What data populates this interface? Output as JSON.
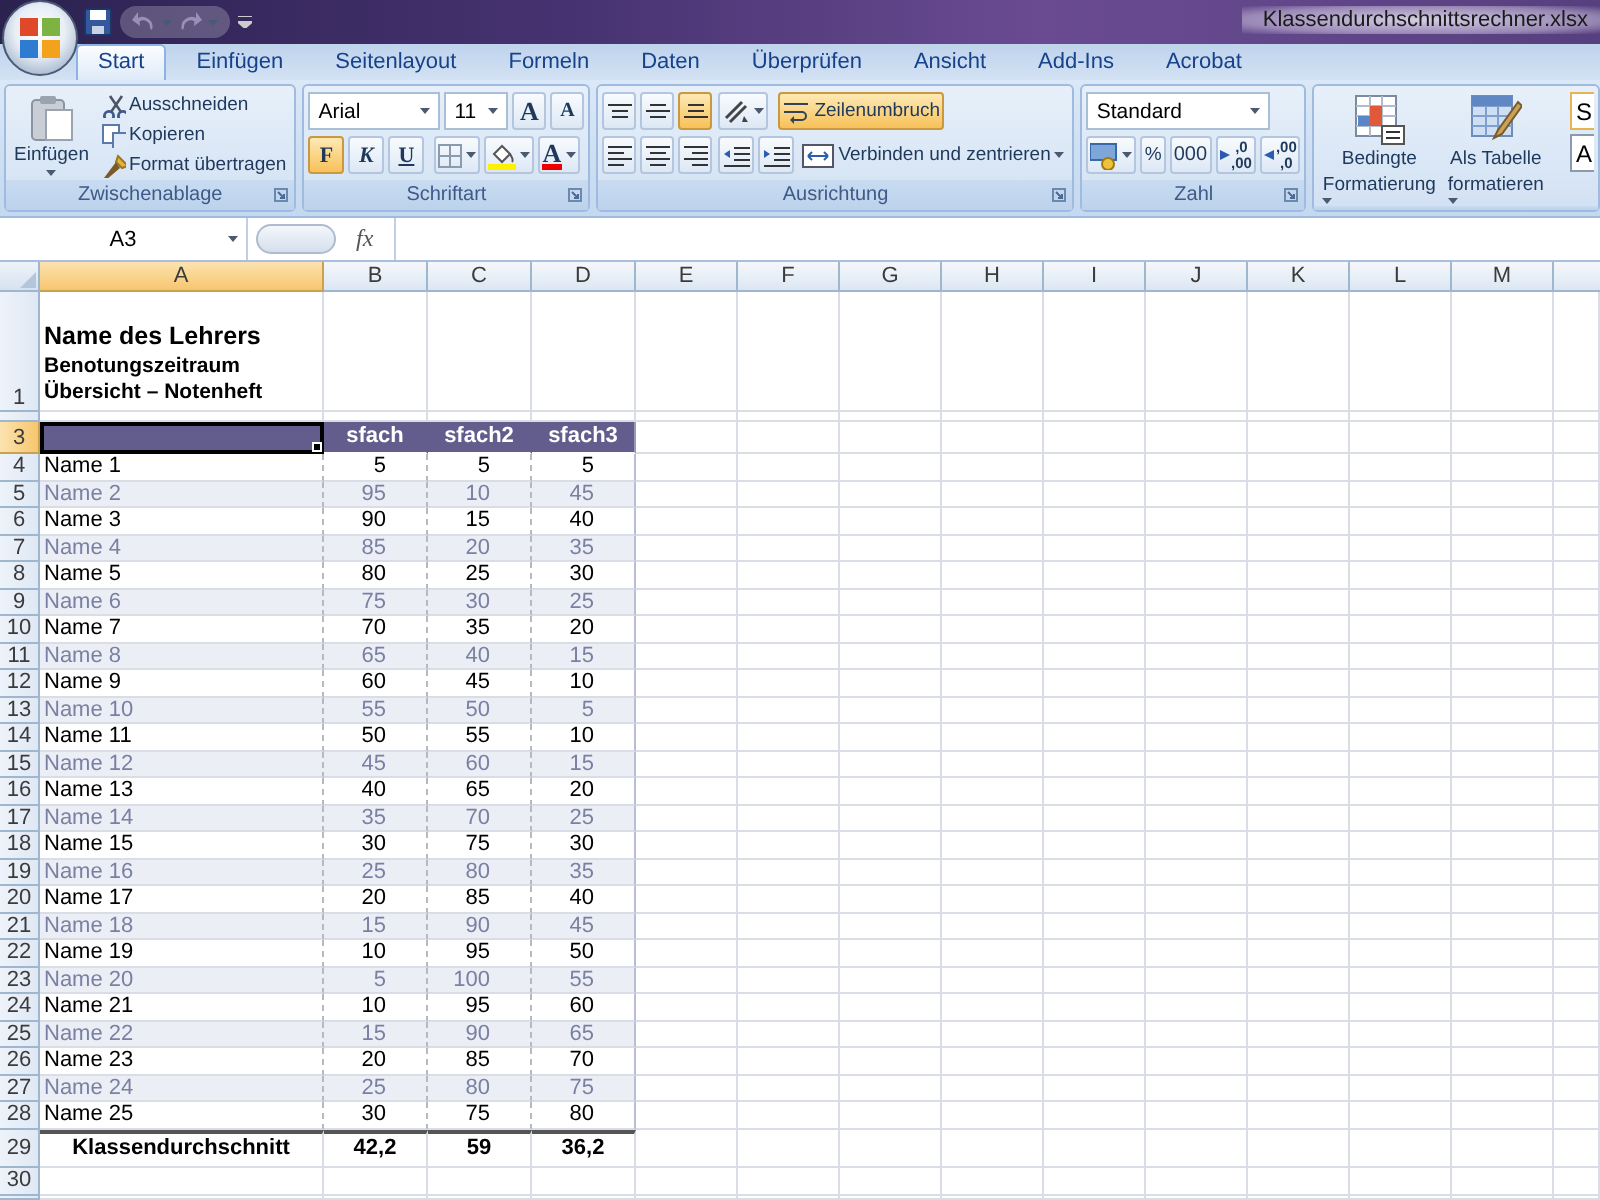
{
  "window": {
    "title": "Klassendurchschnittsrechner.xlsx"
  },
  "tabs": [
    {
      "label": "Start",
      "selected": true
    },
    {
      "label": "Einfügen",
      "selected": false
    },
    {
      "label": "Seitenlayout",
      "selected": false
    },
    {
      "label": "Formeln",
      "selected": false
    },
    {
      "label": "Daten",
      "selected": false
    },
    {
      "label": "Überprüfen",
      "selected": false
    },
    {
      "label": "Ansicht",
      "selected": false
    },
    {
      "label": "Add-Ins",
      "selected": false
    },
    {
      "label": "Acrobat",
      "selected": false
    }
  ],
  "ribbon": {
    "clipboard": {
      "title": "Zwischenablage",
      "paste": "Einfügen",
      "actions": [
        {
          "kind": "cut",
          "label": "Ausschneiden"
        },
        {
          "kind": "copy",
          "label": "Kopieren"
        },
        {
          "kind": "painter",
          "label": "Format übertragen"
        }
      ]
    },
    "font": {
      "title": "Schriftart",
      "font_name": "Arial",
      "font_size": "11",
      "size_buttons": [
        {
          "kind": "grow",
          "label": "A"
        },
        {
          "kind": "shrink",
          "label": "A"
        }
      ],
      "styles": [
        {
          "kind": "bold",
          "label": "F",
          "on": true
        },
        {
          "kind": "italic",
          "label": "K",
          "on": false
        },
        {
          "kind": "underline",
          "label": "U",
          "on": false
        }
      ],
      "font_color_label": "A"
    },
    "alignment": {
      "title": "Ausrichtung",
      "vertical": [
        {
          "kind": "top",
          "on": false
        },
        {
          "kind": "middle",
          "on": false
        },
        {
          "kind": "bottom",
          "on": true
        }
      ],
      "horizontal": [
        {
          "kind": "left",
          "on": false
        },
        {
          "kind": "center",
          "on": false
        },
        {
          "kind": "right",
          "on": false
        }
      ],
      "wrap_text": {
        "label": "Zeilenumbruch",
        "on": true
      },
      "merge": "Verbinden und zentrieren"
    },
    "number": {
      "title": "Zahl",
      "format": "Standard",
      "percent": "%",
      "thousands": "000",
      "decimals": [
        {
          "kind": "increase",
          "top": ",0",
          "bottom": ",00"
        },
        {
          "kind": "decrease",
          "top": ",00",
          "bottom": ",0"
        }
      ]
    },
    "styles": {
      "buttons": [
        {
          "kind": "conditional",
          "lines": [
            "Bedingte",
            "Formatierung"
          ]
        },
        {
          "kind": "table",
          "lines": [
            "Als Tabelle",
            "formatieren"
          ]
        }
      ],
      "gallery": [
        "S",
        "A"
      ]
    }
  },
  "formula_bar": {
    "cell": "A3",
    "function_label": "fx"
  },
  "sheet": {
    "columns": [
      {
        "label": "A",
        "selected": true
      },
      {
        "label": "B",
        "selected": false
      },
      {
        "label": "C",
        "selected": false
      },
      {
        "label": "D",
        "selected": false
      },
      {
        "label": "E",
        "selected": false
      },
      {
        "label": "F",
        "selected": false
      },
      {
        "label": "G",
        "selected": false
      },
      {
        "label": "H",
        "selected": false
      },
      {
        "label": "I",
        "selected": false
      },
      {
        "label": "J",
        "selected": false
      },
      {
        "label": "K",
        "selected": false
      },
      {
        "label": "L",
        "selected": false
      },
      {
        "label": "M",
        "selected": false
      }
    ],
    "title_row": {
      "row": "1",
      "lines": [
        {
          "kind": "title",
          "text": "Name des Lehrers"
        },
        {
          "kind": "subtitle",
          "text": "Benotungszeitraum"
        },
        {
          "kind": "subtitle",
          "text": "Übersicht – Notenheft"
        }
      ]
    },
    "header": {
      "row": "3",
      "selected": true,
      "cells": [
        "sfach",
        "sfach2",
        "sfach3"
      ]
    },
    "rows": [
      {
        "row": "4",
        "name": "Name 1",
        "values": [
          "5",
          "5",
          "5"
        ],
        "shaded": false
      },
      {
        "row": "5",
        "name": "Name 2",
        "values": [
          "95",
          "10",
          "45"
        ],
        "shaded": true
      },
      {
        "row": "6",
        "name": "Name 3",
        "values": [
          "90",
          "15",
          "40"
        ],
        "shaded": false
      },
      {
        "row": "7",
        "name": "Name 4",
        "values": [
          "85",
          "20",
          "35"
        ],
        "shaded": true
      },
      {
        "row": "8",
        "name": "Name 5",
        "values": [
          "80",
          "25",
          "30"
        ],
        "shaded": false
      },
      {
        "row": "9",
        "name": "Name 6",
        "values": [
          "75",
          "30",
          "25"
        ],
        "shaded": true
      },
      {
        "row": "10",
        "name": "Name 7",
        "values": [
          "70",
          "35",
          "20"
        ],
        "shaded": false
      },
      {
        "row": "11",
        "name": "Name 8",
        "values": [
          "65",
          "40",
          "15"
        ],
        "shaded": true
      },
      {
        "row": "12",
        "name": "Name 9",
        "values": [
          "60",
          "45",
          "10"
        ],
        "shaded": false
      },
      {
        "row": "13",
        "name": "Name 10",
        "values": [
          "55",
          "50",
          "5"
        ],
        "shaded": true
      },
      {
        "row": "14",
        "name": "Name 11",
        "values": [
          "50",
          "55",
          "10"
        ],
        "shaded": false
      },
      {
        "row": "15",
        "name": "Name 12",
        "values": [
          "45",
          "60",
          "15"
        ],
        "shaded": true
      },
      {
        "row": "16",
        "name": "Name 13",
        "values": [
          "40",
          "65",
          "20"
        ],
        "shaded": false
      },
      {
        "row": "17",
        "name": "Name 14",
        "values": [
          "35",
          "70",
          "25"
        ],
        "shaded": true
      },
      {
        "row": "18",
        "name": "Name 15",
        "values": [
          "30",
          "75",
          "30"
        ],
        "shaded": false
      },
      {
        "row": "19",
        "name": "Name 16",
        "values": [
          "25",
          "80",
          "35"
        ],
        "shaded": true
      },
      {
        "row": "20",
        "name": "Name 17",
        "values": [
          "20",
          "85",
          "40"
        ],
        "shaded": false
      },
      {
        "row": "21",
        "name": "Name 18",
        "values": [
          "15",
          "90",
          "45"
        ],
        "shaded": true
      },
      {
        "row": "22",
        "name": "Name 19",
        "values": [
          "10",
          "95",
          "50"
        ],
        "shaded": false
      },
      {
        "row": "23",
        "name": "Name 20",
        "values": [
          "5",
          "100",
          "55"
        ],
        "shaded": true
      },
      {
        "row": "24",
        "name": "Name 21",
        "values": [
          "10",
          "95",
          "60"
        ],
        "shaded": false
      },
      {
        "row": "25",
        "name": "Name 22",
        "values": [
          "15",
          "90",
          "65"
        ],
        "shaded": true
      },
      {
        "row": "26",
        "name": "Name 23",
        "values": [
          "20",
          "85",
          "70"
        ],
        "shaded": false
      },
      {
        "row": "27",
        "name": "Name 24",
        "values": [
          "25",
          "80",
          "75"
        ],
        "shaded": true
      },
      {
        "row": "28",
        "name": "Name 25",
        "values": [
          "30",
          "75",
          "80"
        ],
        "shaded": false
      }
    ],
    "total": {
      "row": "29",
      "label": "Klassendurchschnitt",
      "values": [
        "42,2",
        "59",
        "36,2"
      ]
    },
    "empty_rows": [
      "30"
    ]
  }
}
